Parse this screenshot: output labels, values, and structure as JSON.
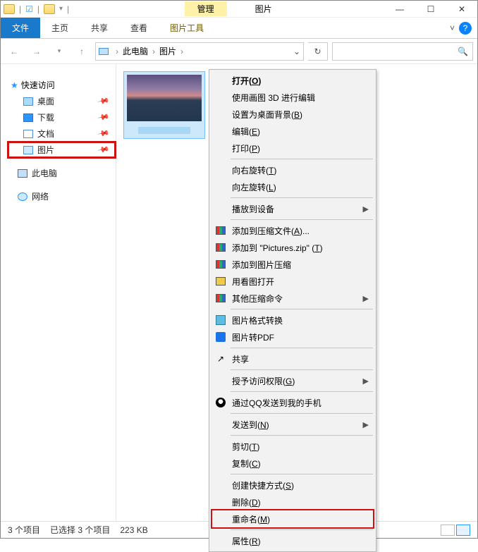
{
  "titlebar": {
    "tab_tools": "管理",
    "title": "图片"
  },
  "ribbon": {
    "file": "文件",
    "home": "主页",
    "share": "共享",
    "view": "查看",
    "pic_tools": "图片工具"
  },
  "addr": {
    "root": "此电脑",
    "current": "图片"
  },
  "sidebar": {
    "quick": "快速访问",
    "items": [
      {
        "label": "桌面"
      },
      {
        "label": "下载"
      },
      {
        "label": "文档"
      },
      {
        "label": "图片"
      }
    ],
    "thispc": "此电脑",
    "network": "网络"
  },
  "status": {
    "count": "3 个项目",
    "selected": "已选择 3 个项目",
    "size": "223 KB"
  },
  "ctx": {
    "open": "打开(O)",
    "paint3d": "使用画图 3D 进行编辑",
    "setbg": "设置为桌面背景(B)",
    "edit": "编辑(E)",
    "print": "打印(P)",
    "rotr": "向右旋转(T)",
    "rotl": "向左旋转(L)",
    "cast": "播放到设备",
    "addzip": "添加到压缩文件(A)...",
    "addzip2": "添加到 \"Pictures.zip\" (T)",
    "addzip3": "添加到图片压缩",
    "openpic": "用看图打开",
    "other": "其他压缩命令",
    "convert": "图片格式转换",
    "topdf": "图片转PDF",
    "sharex": "共享",
    "grant": "授予访问权限(G)",
    "qq": "通过QQ发送到我的手机",
    "sendto": "发送到(N)",
    "cut": "剪切(T)",
    "copy": "复制(C)",
    "shortcut": "创建快捷方式(S)",
    "delete": "删除(D)",
    "rename": "重命名(M)",
    "props": "属性(R)"
  }
}
